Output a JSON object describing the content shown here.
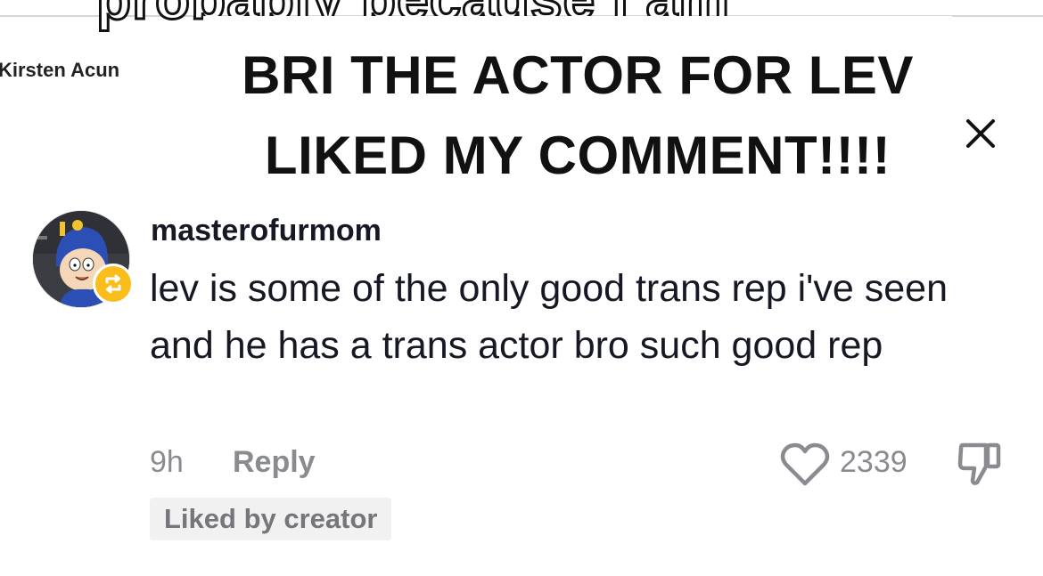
{
  "background": {
    "partial_word": "probably because I am",
    "partial_name": "Kirsten Acun"
  },
  "overlay": {
    "line1": "BRI THE ACTOR FOR LEV",
    "line2": "LIKED MY COMMENT!!!!",
    "close_icon": "close-icon"
  },
  "comment": {
    "username": "masterofurmom",
    "text": "lev is some of the only good trans rep i've seen and he has a trans actor bro such good rep",
    "time": "9h",
    "reply_label": "Reply",
    "like_count": "2339",
    "liked_badge": "Liked by creator",
    "avatar_icon": "avatar",
    "badge_icon": "repost-icon",
    "badge_color": "#fbbd1c",
    "like_icon": "heart-outline-icon",
    "dislike_icon": "thumbs-down-icon"
  }
}
